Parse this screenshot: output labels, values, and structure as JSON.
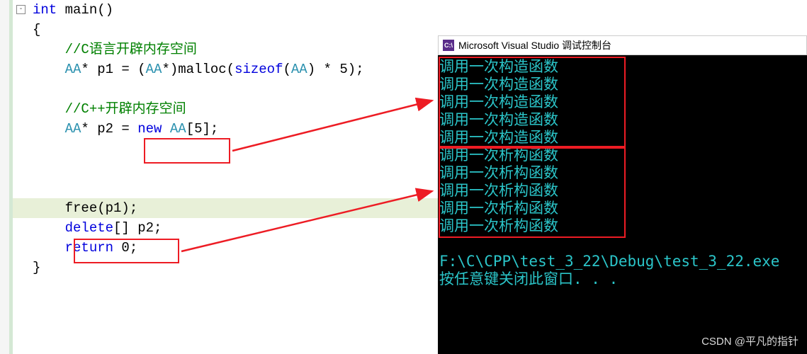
{
  "code": {
    "fn_sig_int": "int",
    "fn_sig_main": " main()",
    "brace_open": "{",
    "comment1": "//C语言开辟内存空间",
    "l3_typ1": "AA",
    "l3_p1": "* p1 = (",
    "l3_typ2": "AA",
    "l3_cast": "*)malloc(",
    "l3_sizeof": "sizeof",
    "l3_open": "(",
    "l3_typ3": "AA",
    "l3_rest": ") * 5);",
    "comment2": "//C++开辟内存空间",
    "l5_typ": "AA",
    "l5_p2": "* p2 = ",
    "l5_new": "new",
    "l5_sp": " ",
    "l5_typ2": "AA",
    "l5_arr": "[5];",
    "l6_free": "free(p1);",
    "l7_del": "delete",
    "l7_rest": "[] p2;",
    "l8_ret": "return",
    "l8_zero": " 0;",
    "brace_close": "}"
  },
  "console": {
    "title": "Microsoft Visual Studio 调试控制台",
    "icon_text": "C:\\",
    "lines_ctor": [
      "调用一次构造函数",
      "调用一次构造函数",
      "调用一次构造函数",
      "调用一次构造函数",
      "调用一次构造函数"
    ],
    "lines_dtor": [
      "调用一次析构函数",
      "调用一次析构函数",
      "调用一次析构函数",
      "调用一次析构函数",
      "调用一次析构函数"
    ],
    "path_line": "F:\\C\\CPP\\test_3_22\\Debug\\test_3_22.exe",
    "prompt_line": "按任意键关闭此窗口. . ."
  },
  "watermark": "CSDN @平凡的指针"
}
